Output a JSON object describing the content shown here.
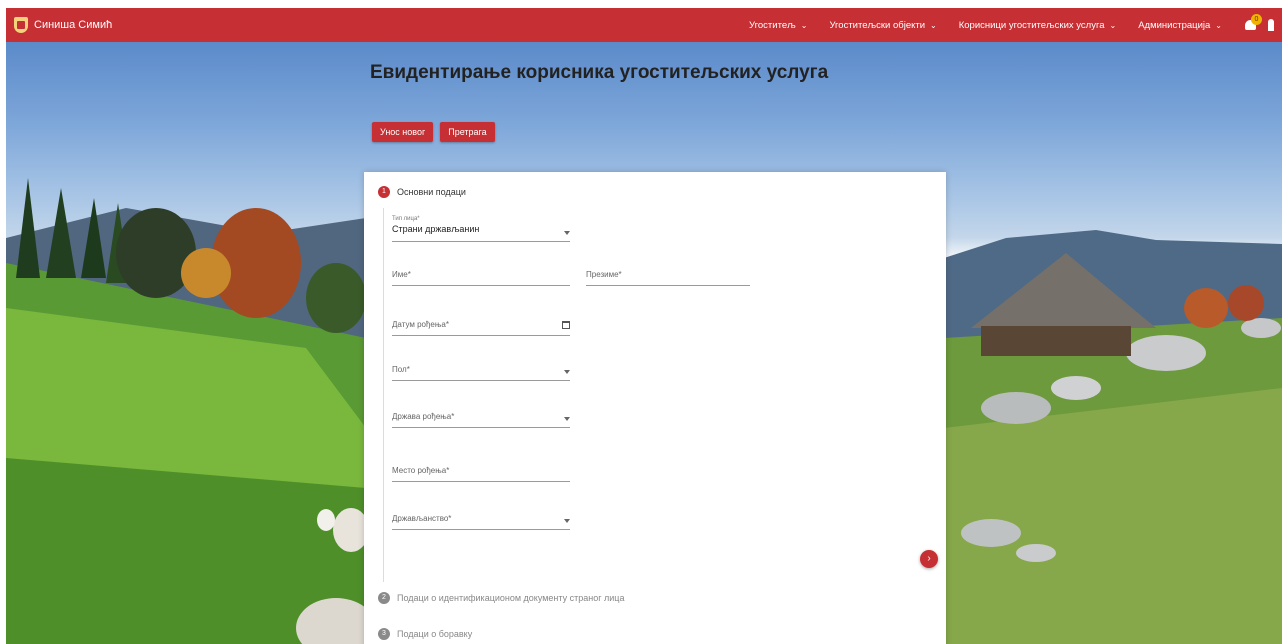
{
  "navbar": {
    "brand_name": "Синиша Симић",
    "menu": [
      {
        "label": "Угоститељ",
        "chevron": "⌄"
      },
      {
        "label": "Угоститељски објекти",
        "chevron": "⌄"
      },
      {
        "label": "Корисници угоститељских услуга",
        "chevron": "⌄"
      },
      {
        "label": "Администрација",
        "chevron": "⌄"
      }
    ],
    "notification_count": "0",
    "accent_color": "#c62f33"
  },
  "page": {
    "title": "Евидентирање корисника угоститељских услуга",
    "actions": {
      "new_label": "Унос новог",
      "search_label": "Претрага"
    }
  },
  "stepper": {
    "steps": [
      {
        "number": "1",
        "label": "Основни подаци"
      },
      {
        "number": "2",
        "label": "Подаци о идентификационом документу страног лица"
      },
      {
        "number": "3",
        "label": "Подаци о боравку"
      }
    ],
    "fields": {
      "person_type": {
        "label": "Тип лица*",
        "value": "Страни држављанин"
      },
      "first_name": {
        "label": "Име*"
      },
      "last_name": {
        "label": "Презиме*"
      },
      "birth_date": {
        "label": "Датум рођења*"
      },
      "gender": {
        "label": "Пол*"
      },
      "birth_country": {
        "label": "Држава рођења*"
      },
      "birth_place": {
        "label": "Место рођења*"
      },
      "citizenship": {
        "label": "Држављанство*"
      }
    },
    "next_icon": "›"
  }
}
